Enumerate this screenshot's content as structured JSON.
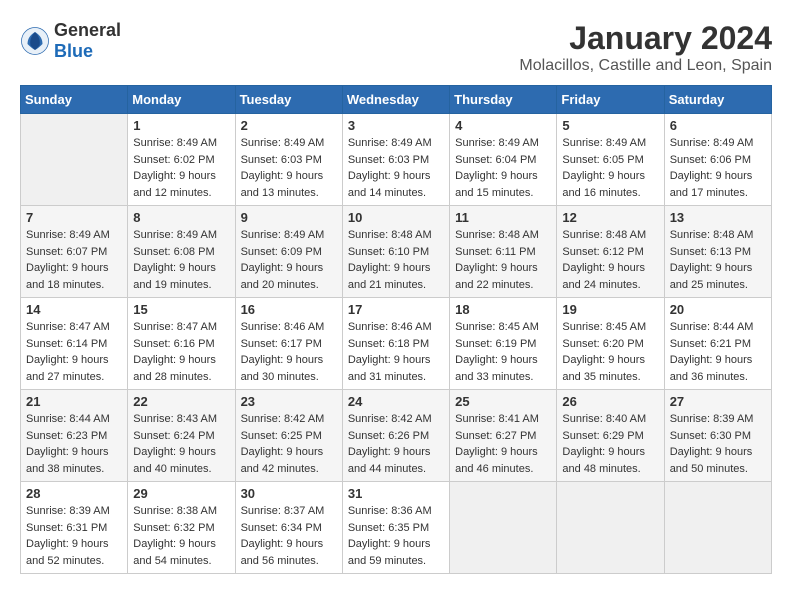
{
  "header": {
    "logo_general": "General",
    "logo_blue": "Blue",
    "month_year": "January 2024",
    "location": "Molacillos, Castille and Leon, Spain"
  },
  "weekdays": [
    "Sunday",
    "Monday",
    "Tuesday",
    "Wednesday",
    "Thursday",
    "Friday",
    "Saturday"
  ],
  "weeks": [
    [
      {
        "day": "",
        "empty": true
      },
      {
        "day": "1",
        "sunrise": "Sunrise: 8:49 AM",
        "sunset": "Sunset: 6:02 PM",
        "daylight": "Daylight: 9 hours and 12 minutes."
      },
      {
        "day": "2",
        "sunrise": "Sunrise: 8:49 AM",
        "sunset": "Sunset: 6:03 PM",
        "daylight": "Daylight: 9 hours and 13 minutes."
      },
      {
        "day": "3",
        "sunrise": "Sunrise: 8:49 AM",
        "sunset": "Sunset: 6:03 PM",
        "daylight": "Daylight: 9 hours and 14 minutes."
      },
      {
        "day": "4",
        "sunrise": "Sunrise: 8:49 AM",
        "sunset": "Sunset: 6:04 PM",
        "daylight": "Daylight: 9 hours and 15 minutes."
      },
      {
        "day": "5",
        "sunrise": "Sunrise: 8:49 AM",
        "sunset": "Sunset: 6:05 PM",
        "daylight": "Daylight: 9 hours and 16 minutes."
      },
      {
        "day": "6",
        "sunrise": "Sunrise: 8:49 AM",
        "sunset": "Sunset: 6:06 PM",
        "daylight": "Daylight: 9 hours and 17 minutes."
      }
    ],
    [
      {
        "day": "7",
        "sunrise": "Sunrise: 8:49 AM",
        "sunset": "Sunset: 6:07 PM",
        "daylight": "Daylight: 9 hours and 18 minutes."
      },
      {
        "day": "8",
        "sunrise": "Sunrise: 8:49 AM",
        "sunset": "Sunset: 6:08 PM",
        "daylight": "Daylight: 9 hours and 19 minutes."
      },
      {
        "day": "9",
        "sunrise": "Sunrise: 8:49 AM",
        "sunset": "Sunset: 6:09 PM",
        "daylight": "Daylight: 9 hours and 20 minutes."
      },
      {
        "day": "10",
        "sunrise": "Sunrise: 8:48 AM",
        "sunset": "Sunset: 6:10 PM",
        "daylight": "Daylight: 9 hours and 21 minutes."
      },
      {
        "day": "11",
        "sunrise": "Sunrise: 8:48 AM",
        "sunset": "Sunset: 6:11 PM",
        "daylight": "Daylight: 9 hours and 22 minutes."
      },
      {
        "day": "12",
        "sunrise": "Sunrise: 8:48 AM",
        "sunset": "Sunset: 6:12 PM",
        "daylight": "Daylight: 9 hours and 24 minutes."
      },
      {
        "day": "13",
        "sunrise": "Sunrise: 8:48 AM",
        "sunset": "Sunset: 6:13 PM",
        "daylight": "Daylight: 9 hours and 25 minutes."
      }
    ],
    [
      {
        "day": "14",
        "sunrise": "Sunrise: 8:47 AM",
        "sunset": "Sunset: 6:14 PM",
        "daylight": "Daylight: 9 hours and 27 minutes."
      },
      {
        "day": "15",
        "sunrise": "Sunrise: 8:47 AM",
        "sunset": "Sunset: 6:16 PM",
        "daylight": "Daylight: 9 hours and 28 minutes."
      },
      {
        "day": "16",
        "sunrise": "Sunrise: 8:46 AM",
        "sunset": "Sunset: 6:17 PM",
        "daylight": "Daylight: 9 hours and 30 minutes."
      },
      {
        "day": "17",
        "sunrise": "Sunrise: 8:46 AM",
        "sunset": "Sunset: 6:18 PM",
        "daylight": "Daylight: 9 hours and 31 minutes."
      },
      {
        "day": "18",
        "sunrise": "Sunrise: 8:45 AM",
        "sunset": "Sunset: 6:19 PM",
        "daylight": "Daylight: 9 hours and 33 minutes."
      },
      {
        "day": "19",
        "sunrise": "Sunrise: 8:45 AM",
        "sunset": "Sunset: 6:20 PM",
        "daylight": "Daylight: 9 hours and 35 minutes."
      },
      {
        "day": "20",
        "sunrise": "Sunrise: 8:44 AM",
        "sunset": "Sunset: 6:21 PM",
        "daylight": "Daylight: 9 hours and 36 minutes."
      }
    ],
    [
      {
        "day": "21",
        "sunrise": "Sunrise: 8:44 AM",
        "sunset": "Sunset: 6:23 PM",
        "daylight": "Daylight: 9 hours and 38 minutes."
      },
      {
        "day": "22",
        "sunrise": "Sunrise: 8:43 AM",
        "sunset": "Sunset: 6:24 PM",
        "daylight": "Daylight: 9 hours and 40 minutes."
      },
      {
        "day": "23",
        "sunrise": "Sunrise: 8:42 AM",
        "sunset": "Sunset: 6:25 PM",
        "daylight": "Daylight: 9 hours and 42 minutes."
      },
      {
        "day": "24",
        "sunrise": "Sunrise: 8:42 AM",
        "sunset": "Sunset: 6:26 PM",
        "daylight": "Daylight: 9 hours and 44 minutes."
      },
      {
        "day": "25",
        "sunrise": "Sunrise: 8:41 AM",
        "sunset": "Sunset: 6:27 PM",
        "daylight": "Daylight: 9 hours and 46 minutes."
      },
      {
        "day": "26",
        "sunrise": "Sunrise: 8:40 AM",
        "sunset": "Sunset: 6:29 PM",
        "daylight": "Daylight: 9 hours and 48 minutes."
      },
      {
        "day": "27",
        "sunrise": "Sunrise: 8:39 AM",
        "sunset": "Sunset: 6:30 PM",
        "daylight": "Daylight: 9 hours and 50 minutes."
      }
    ],
    [
      {
        "day": "28",
        "sunrise": "Sunrise: 8:39 AM",
        "sunset": "Sunset: 6:31 PM",
        "daylight": "Daylight: 9 hours and 52 minutes."
      },
      {
        "day": "29",
        "sunrise": "Sunrise: 8:38 AM",
        "sunset": "Sunset: 6:32 PM",
        "daylight": "Daylight: 9 hours and 54 minutes."
      },
      {
        "day": "30",
        "sunrise": "Sunrise: 8:37 AM",
        "sunset": "Sunset: 6:34 PM",
        "daylight": "Daylight: 9 hours and 56 minutes."
      },
      {
        "day": "31",
        "sunrise": "Sunrise: 8:36 AM",
        "sunset": "Sunset: 6:35 PM",
        "daylight": "Daylight: 9 hours and 59 minutes."
      },
      {
        "day": "",
        "empty": true
      },
      {
        "day": "",
        "empty": true
      },
      {
        "day": "",
        "empty": true
      }
    ]
  ]
}
